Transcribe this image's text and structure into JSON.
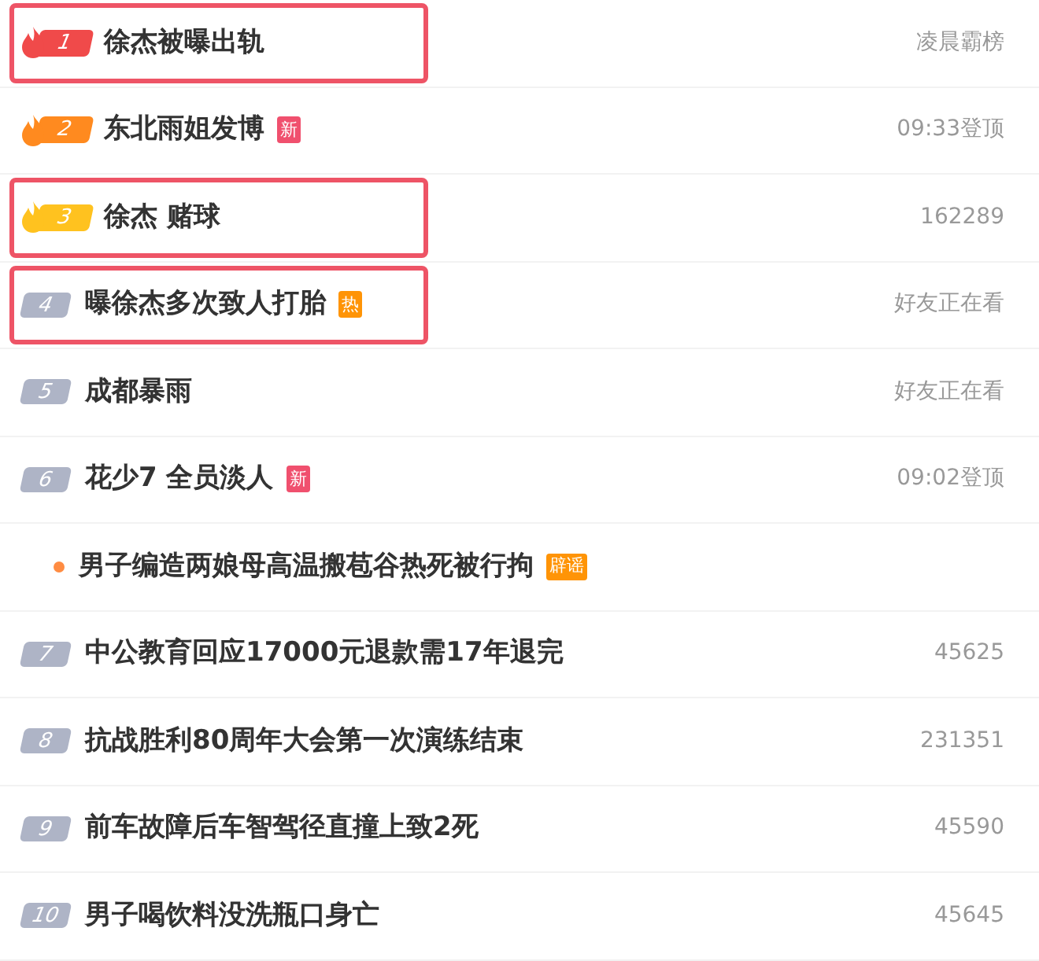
{
  "rows": [
    {
      "kind": "top",
      "rank": "1",
      "color": "#f04a4a",
      "title": "徐杰被曝出轨",
      "meta": "凌晨霸榜",
      "highlighted": true
    },
    {
      "kind": "top",
      "rank": "2",
      "color": "#ff8a1f",
      "title": "东北雨姐发博",
      "tag": {
        "text": "新",
        "color": "#f0506e"
      },
      "meta": "09:33登顶",
      "highlighted": false
    },
    {
      "kind": "top",
      "rank": "3",
      "color": "#ffc21f",
      "title": "徐杰 赌球",
      "meta": "162289",
      "highlighted": true
    },
    {
      "kind": "normal",
      "rank": "4",
      "title": "曝徐杰多次致人打胎",
      "tag": {
        "text": "热",
        "color": "#ff9406"
      },
      "meta": "好友正在看",
      "highlighted": true
    },
    {
      "kind": "normal",
      "rank": "5",
      "title": "成都暴雨",
      "meta": "好友正在看",
      "highlighted": false
    },
    {
      "kind": "normal",
      "rank": "6",
      "title": "花少7 全员淡人",
      "tag": {
        "text": "新",
        "color": "#f0506e"
      },
      "meta": "09:02登顶",
      "highlighted": false
    },
    {
      "kind": "dot",
      "title": "男子编造两娘母高温搬苞谷热死被行拘",
      "tag": {
        "text": "辟谣",
        "color": "#ff9406"
      },
      "highlighted": false
    },
    {
      "kind": "normal",
      "rank": "7",
      "title": "中公教育回应17000元退款需17年退完",
      "meta": "45625",
      "highlighted": false
    },
    {
      "kind": "normal",
      "rank": "8",
      "title": "抗战胜利80周年大会第一次演练结束",
      "meta": "231351",
      "highlighted": false
    },
    {
      "kind": "normal",
      "rank": "9",
      "title": "前车故障后车智驾径直撞上致2死",
      "meta": "45590",
      "highlighted": false
    },
    {
      "kind": "normal",
      "rank": "10",
      "title": "男子喝饮料没洗瓶口身亡",
      "meta": "45645",
      "highlighted": false
    }
  ]
}
